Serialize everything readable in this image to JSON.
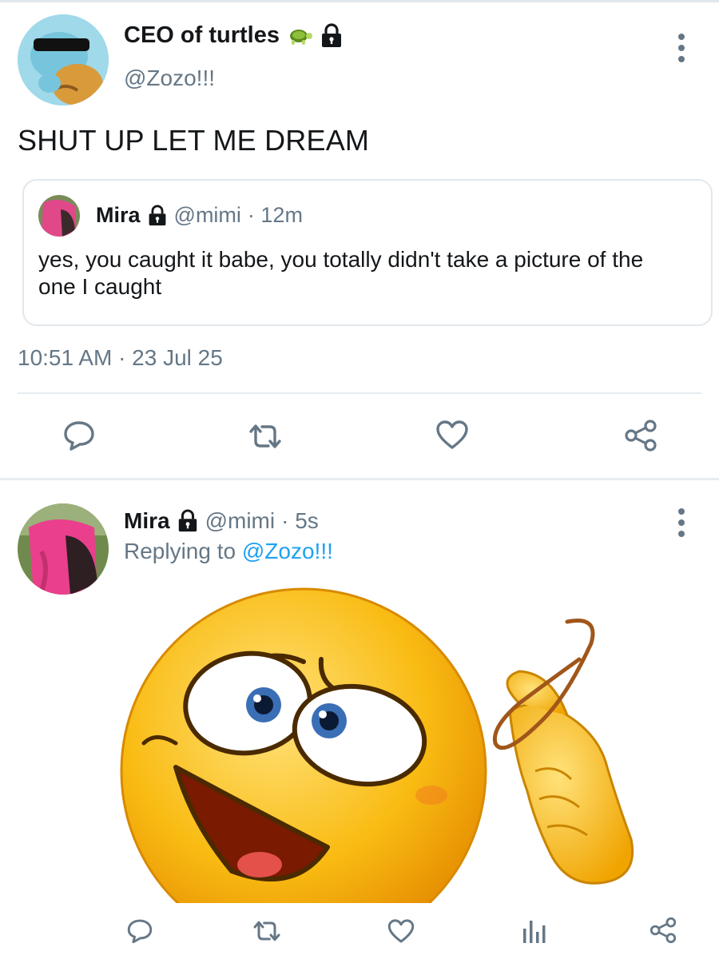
{
  "top_tweet": {
    "display_name": "CEO of turtles",
    "handle": "@Zozo!!!",
    "text": "SHUT UP LET ME DREAM",
    "timestamp": "10:51 AM · 23 Jul 25"
  },
  "quoted_tweet": {
    "display_name": "Mira",
    "handle": "@mimi",
    "age": "· 12m",
    "text": "yes, you caught it babe, you totally didn't take a picture of the one I caught"
  },
  "reply_tweet": {
    "display_name": "Mira",
    "handle": "@mimi",
    "age": "· 5s",
    "replying_prefix": "Replying to ",
    "replying_to": "@Zozo!!!"
  },
  "icons": [
    "reply-icon",
    "retweet-icon",
    "like-icon",
    "share-icon",
    "analytics-icon",
    "more-options-icon",
    "lock-icon",
    "turtle-emoji"
  ],
  "colors": {
    "text": "#14171a",
    "secondary": "#657786",
    "link": "#1da1f2",
    "divider": "#e6ecf0",
    "emoji_yellow": "#f7b500"
  }
}
